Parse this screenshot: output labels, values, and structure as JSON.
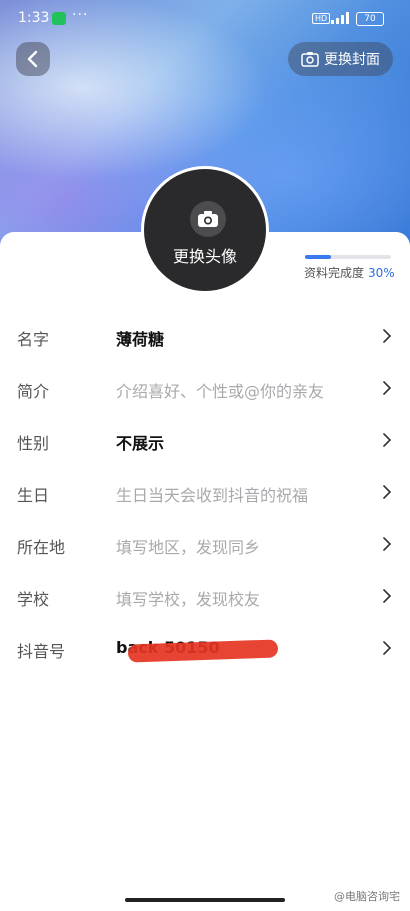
{
  "status_bar": {
    "time": "1:33",
    "dots": "···",
    "network_label": "HD",
    "battery": "70"
  },
  "header": {
    "back_icon": "chevron-left-icon",
    "change_cover_label": "更换封面"
  },
  "avatar": {
    "change_label": "更换头像"
  },
  "profile_completion": {
    "label": "资料完成度",
    "percent_text": "30%",
    "fraction": 0.3
  },
  "fields": [
    {
      "label": "名字",
      "value": "薄荷糖",
      "is_placeholder": false
    },
    {
      "label": "简介",
      "value": "介绍喜好、个性或@你的亲友",
      "is_placeholder": true
    },
    {
      "label": "性别",
      "value": "不展示",
      "is_placeholder": false
    },
    {
      "label": "生日",
      "value": "生日当天会收到抖音的祝福",
      "is_placeholder": true
    },
    {
      "label": "所在地",
      "value": "填写地区，发现同乡",
      "is_placeholder": true
    },
    {
      "label": "学校",
      "value": "填写学校，发现校友",
      "is_placeholder": true
    },
    {
      "label": "抖音号",
      "value": "back 50150",
      "is_placeholder": false
    }
  ],
  "watermark": "@电脑咨询宅",
  "colors": {
    "accent": "#3a7af0",
    "redaction": "#e53423"
  }
}
